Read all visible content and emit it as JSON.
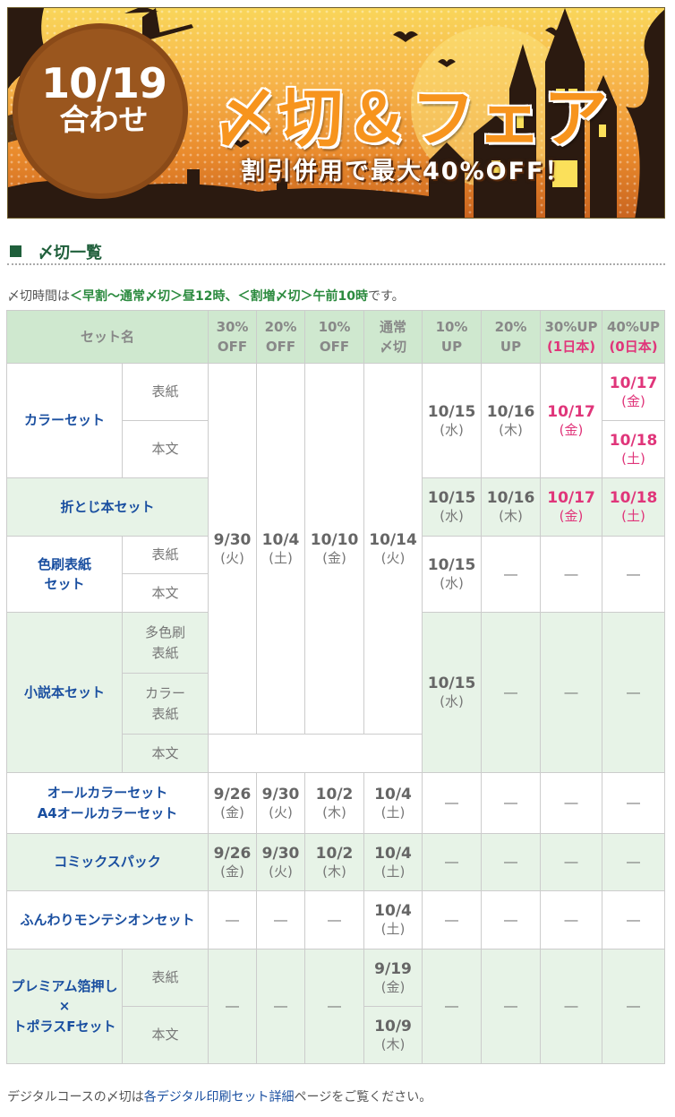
{
  "banner": {
    "date": "10/19",
    "date_suffix": "合わせ",
    "title": "〆切＆フェア",
    "subtitle": "割引併用で最大40%OFF！"
  },
  "section": {
    "title": "〆切一覧"
  },
  "note": {
    "prefix": "〆切時間は",
    "part1": "＜早割～通常〆切＞昼12時、",
    "part2": "＜割増〆切＞午前10時",
    "suffix": "です。"
  },
  "table": {
    "headers": {
      "set": "セット名",
      "c1a": "30%",
      "c1b": "OFF",
      "c2a": "20%",
      "c2b": "OFF",
      "c3a": "10%",
      "c3b": "OFF",
      "c4a": "通常",
      "c4b": "〆切",
      "c5a": "10%",
      "c5b": "UP",
      "c6a": "20%",
      "c6b": "UP",
      "c7a": "30%UP",
      "c7b": "(1日本)",
      "c8a": "40%UP",
      "c8b": "(0日本)"
    },
    "dash": "―",
    "color_set": {
      "name": "カラーセット",
      "sub1": "表紙",
      "sub2": "本文"
    },
    "orito": {
      "name": "折とじ本セット"
    },
    "irozuri": {
      "name1": "色刷表紙",
      "name2": "セット",
      "sub1": "表紙",
      "sub2": "本文"
    },
    "shosetsu": {
      "name": "小説本セット",
      "sub1a": "多色刷",
      "sub1b": "表紙",
      "sub2a": "カラー",
      "sub2b": "表紙",
      "sub3": "本文"
    },
    "allcolor": {
      "name1": "オールカラーセット",
      "name2": "A4オールカラーセット"
    },
    "comics": {
      "name": "コミックスパック"
    },
    "funwari": {
      "name": "ふんわりモンテシオンセット"
    },
    "premium": {
      "name1": "プレミアム箔押し",
      "name2": "×",
      "name3": "トポラスFセット",
      "sub1": "表紙",
      "sub2": "本文"
    },
    "d": {
      "d0930": "9/30",
      "w_ka": "(火)",
      "d1004": "10/4",
      "w_do": "(土)",
      "d1010": "10/10",
      "w_kin": "(金)",
      "d1014": "10/14",
      "d1015": "10/15",
      "w_sui": "(水)",
      "d1016": "10/16",
      "w_moku": "(木)",
      "d1017": "10/17",
      "d1018": "10/18",
      "d0926": "9/26",
      "d1002": "10/2",
      "d0919": "9/19",
      "d1009": "10/9"
    }
  },
  "footer": {
    "prefix": "デジタルコースの〆切は",
    "link": "各デジタル印刷セット詳細",
    "suffix": "ページをご覧ください。"
  },
  "colors": {
    "accent_green": "#1f5f3b",
    "header_bg": "#cfe8cf",
    "alt_row": "#e7f3e7",
    "pink": "#e0357a",
    "link_blue": "#1a4fa0"
  }
}
